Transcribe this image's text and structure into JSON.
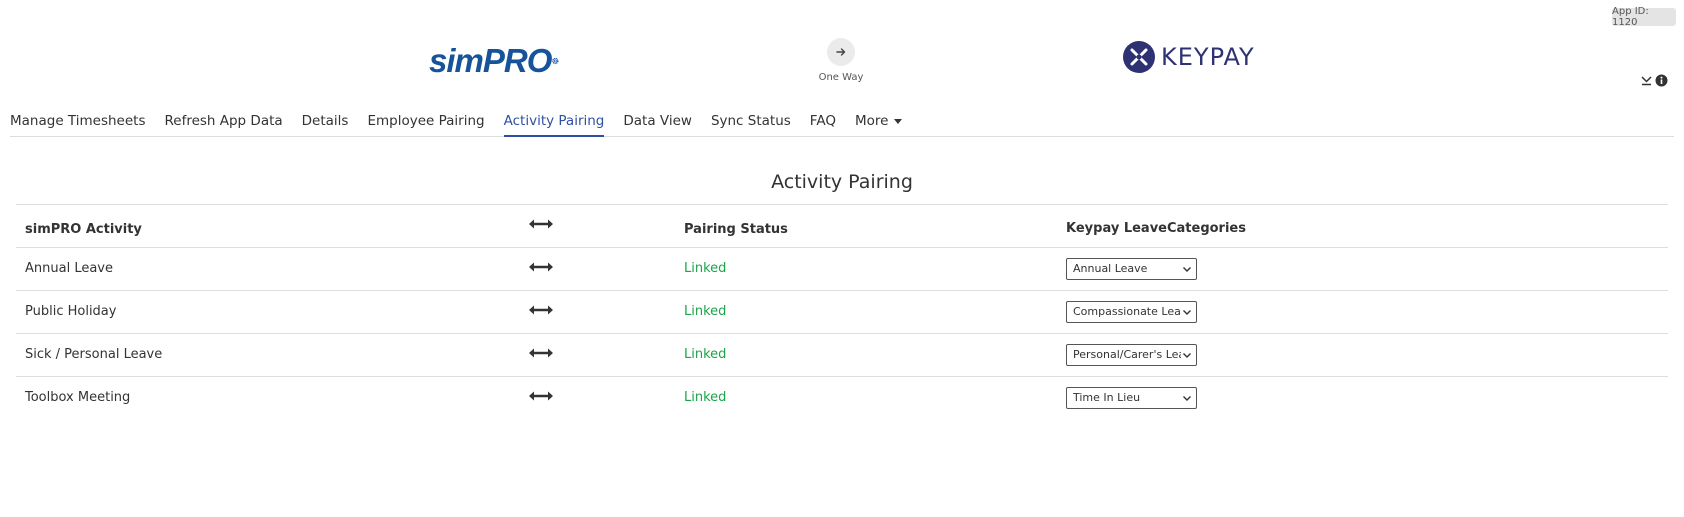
{
  "app_id": "App ID: 1120",
  "header": {
    "left_logo": {
      "part1": "sim",
      "part2": "PRO"
    },
    "sync": {
      "label": "One Way",
      "icon": "arrow-right-icon"
    },
    "right_logo": {
      "wordmark": "KEYPAY"
    }
  },
  "nav": {
    "tabs": [
      {
        "label": "Manage Timesheets"
      },
      {
        "label": "Refresh App Data"
      },
      {
        "label": "Details"
      },
      {
        "label": "Employee Pairing"
      },
      {
        "label": "Activity Pairing",
        "active": true
      },
      {
        "label": "Data View"
      },
      {
        "label": "Sync Status"
      },
      {
        "label": "FAQ"
      },
      {
        "label": "More"
      }
    ]
  },
  "page_title": "Activity Pairing",
  "table": {
    "headers": {
      "source": "simPRO Activity",
      "status": "Pairing Status",
      "target": "Keypay LeaveCategories"
    },
    "rows": [
      {
        "activity": "Annual Leave",
        "status": "Linked",
        "category": "Annual Leave"
      },
      {
        "activity": "Public Holiday",
        "status": "Linked",
        "category": "Compassionate Leave"
      },
      {
        "activity": "Sick / Personal Leave",
        "status": "Linked",
        "category": "Personal/Carer's Leave"
      },
      {
        "activity": "Toolbox Meeting",
        "status": "Linked",
        "category": "Time In Lieu"
      }
    ]
  },
  "colors": {
    "simpro_blue": "#17539a",
    "keypay_navy": "#2e3272",
    "active_tab": "#2f4fa2",
    "linked_green": "#1aa34a"
  }
}
